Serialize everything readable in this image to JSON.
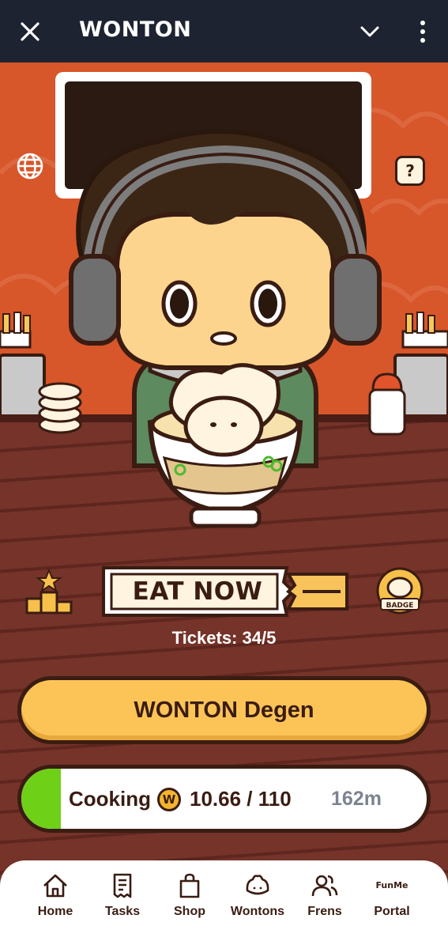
{
  "window": {
    "title": "WONTON"
  },
  "game": {
    "eat_label": "EAT NOW",
    "tickets_label": "Tickets:",
    "tickets_value": "34/5",
    "badge_text": "BADGE",
    "help_symbol": "?",
    "degen_label": "WONTON Degen",
    "cooking": {
      "label": "Cooking",
      "coin_symbol": "W",
      "amount": "10.66 / 110",
      "time_left": "162m",
      "progress_fraction": 0.097
    }
  },
  "nav": {
    "items": [
      {
        "label": "Home",
        "icon": "home-icon"
      },
      {
        "label": "Tasks",
        "icon": "receipt-icon"
      },
      {
        "label": "Shop",
        "icon": "bag-icon"
      },
      {
        "label": "Wontons",
        "icon": "dumpling-icon"
      },
      {
        "label": "Frens",
        "icon": "friends-icon"
      },
      {
        "label": "Portal",
        "icon": "funme-icon",
        "brand": "FunMe"
      }
    ]
  },
  "colors": {
    "topbar": "#1e2332",
    "wall": "#d7562a",
    "counter": "#753329",
    "primary_button": "#fcc457",
    "progress": "#6ed118",
    "ink": "#3a1c12"
  }
}
